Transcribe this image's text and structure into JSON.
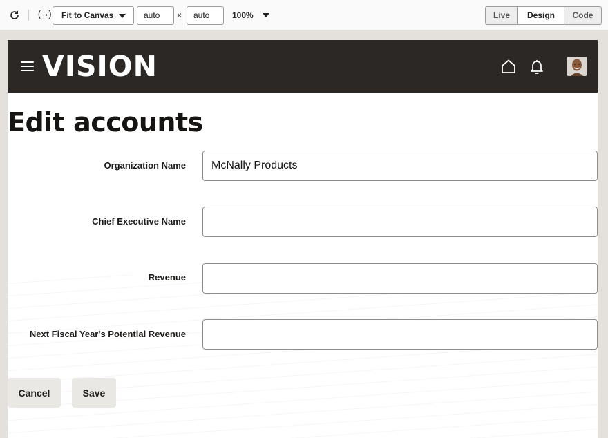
{
  "toolbar": {
    "expression_icon": "(→)",
    "fit_select": "Fit to Canvas",
    "width_value": "auto",
    "times": "×",
    "height_value": "auto",
    "zoom": "100%",
    "modes": [
      "Live",
      "Design",
      "Code"
    ],
    "active_mode": "Design"
  },
  "header": {
    "logo": "VISION",
    "icons": [
      "menu-icon",
      "home-icon",
      "bell-icon",
      "avatar"
    ],
    "colors": {
      "background": "#2b2825",
      "foreground": "#ffffff"
    }
  },
  "page": {
    "title": "Edit accounts"
  },
  "form": {
    "fields": [
      {
        "label": "Organization Name",
        "value": "McNally Products"
      },
      {
        "label": "Chief Executive Name",
        "value": ""
      },
      {
        "label": "Revenue",
        "value": ""
      },
      {
        "label": "Next Fiscal Year's Potential Revenue",
        "value": ""
      }
    ],
    "cancel_label": "Cancel",
    "save_label": "Save"
  }
}
